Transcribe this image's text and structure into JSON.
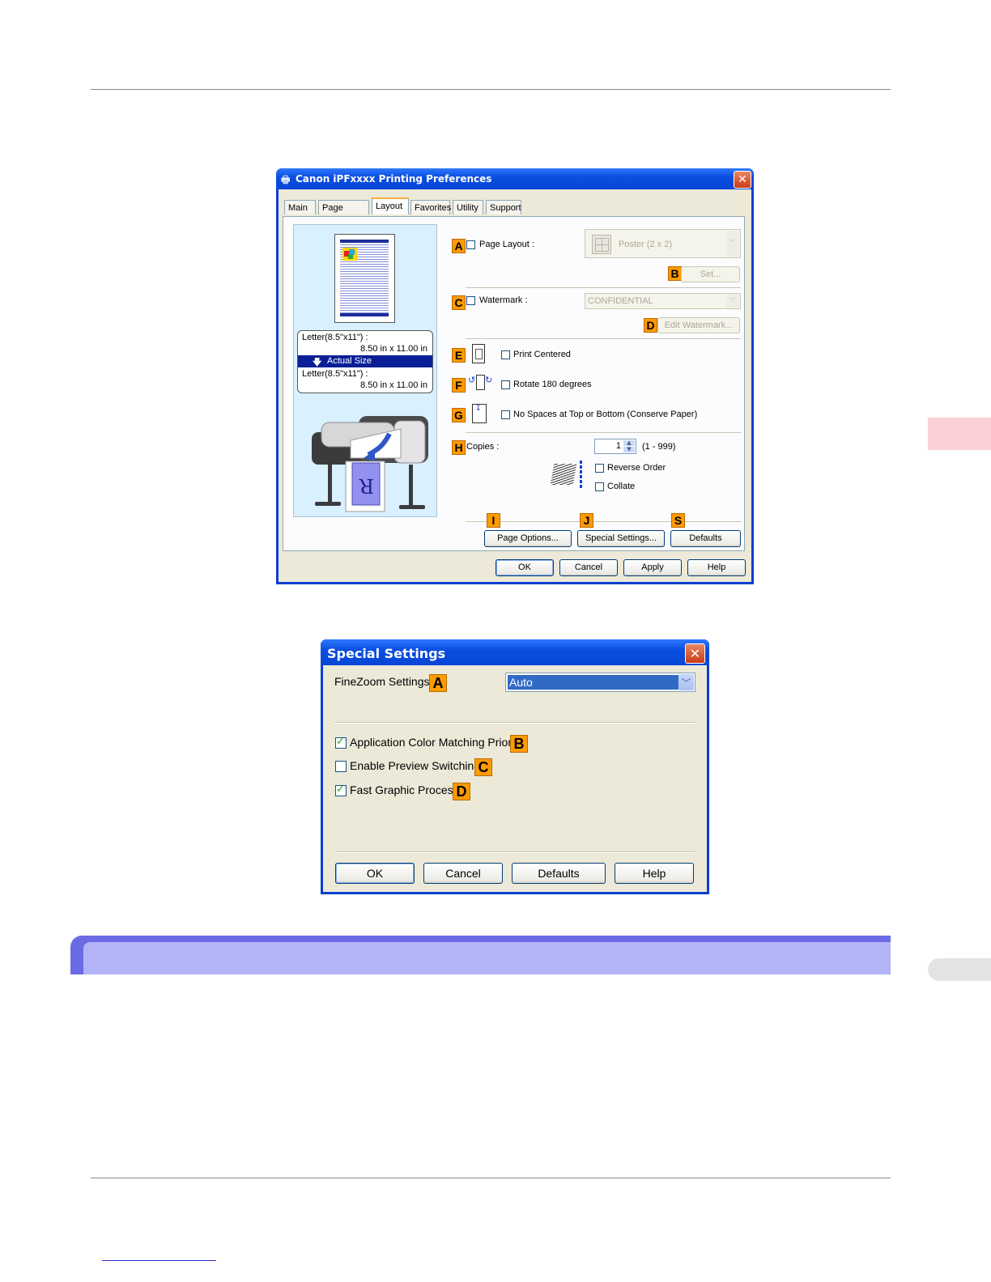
{
  "side_tabs": [
    {
      "color": "#fbd0d6"
    },
    {
      "color": "#e3e3e3"
    }
  ],
  "printing_prefs": {
    "title": "Canon iPFxxxx Printing Preferences",
    "close": "✕",
    "tabs": [
      "Main",
      "Page Setup",
      "Layout",
      "Favorites",
      "Utility",
      "Support"
    ],
    "active_tab": "Layout",
    "preview": {
      "paper1_label": "Letter(8.5\"x11\") :",
      "paper1_size": "8.50 in x 11.00 in",
      "scale_label": "Actual Size",
      "paper2_label": "Letter(8.5\"x11\") :",
      "paper2_size": "8.50 in x 11.00 in",
      "output_letter": "R"
    },
    "page_layout": {
      "badge": "A",
      "label": "Page Layout :",
      "value": "Poster (2 x 2)",
      "checked": false
    },
    "set_button": {
      "badge": "B",
      "label": "Set..."
    },
    "watermark": {
      "badge": "C",
      "label": "Watermark :",
      "value": "CONFIDENTIAL",
      "checked": false
    },
    "edit_watermark": {
      "badge": "D",
      "label": "Edit Watermark..."
    },
    "print_centered": {
      "badge": "E",
      "label": "Print Centered",
      "checked": false
    },
    "rotate": {
      "badge": "F",
      "label": "Rotate 180 degrees",
      "checked": false
    },
    "no_spaces": {
      "badge": "G",
      "label": "No Spaces at Top or Bottom (Conserve Paper)",
      "checked": false
    },
    "copies": {
      "badge": "H",
      "label": "Copies :",
      "value": "1",
      "range": "(1 - 999)"
    },
    "reverse_order": {
      "label": "Reverse Order",
      "checked": false
    },
    "collate": {
      "label": "Collate",
      "checked": false
    },
    "page_options": {
      "badge": "I",
      "label": "Page Options..."
    },
    "special_settings": {
      "badge": "J",
      "label": "Special Settings..."
    },
    "defaults": {
      "badge": "S",
      "label": "Defaults"
    },
    "footer": {
      "ok": "OK",
      "cancel": "Cancel",
      "apply": "Apply",
      "help": "Help"
    }
  },
  "special_settings": {
    "title": "Special Settings",
    "close": "✕",
    "finezoom": {
      "label": "FineZoom Settings :",
      "badge": "A",
      "value": "Auto"
    },
    "app_color": {
      "label": "Application Color Matching Priority",
      "badge": "B",
      "checked": true
    },
    "preview_switch": {
      "label": "Enable Preview Switching",
      "badge": "C",
      "checked": false
    },
    "fast_graphic": {
      "label": "Fast Graphic Process",
      "badge": "D",
      "checked": true
    },
    "footer": {
      "ok": "OK",
      "cancel": "Cancel",
      "defaults": "Defaults",
      "help": "Help"
    }
  },
  "section_header": {
    "text": ""
  },
  "colors": {
    "section_band": "#b3b3f7",
    "section_edge": "#6b6be6",
    "xp_blue": "#0a4fe0",
    "badge": "#ff9a00"
  }
}
